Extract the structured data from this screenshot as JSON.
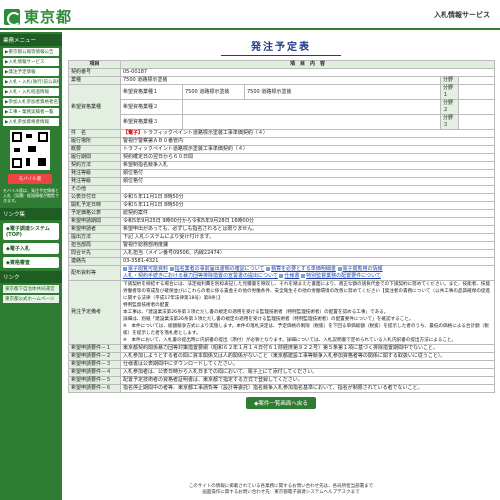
{
  "header": {
    "logo_text": "東京都",
    "service_title": "入札情報サービス"
  },
  "sidebar": {
    "section1": "業務メニュー",
    "items": [
      "▶東京都公報等情報公告",
      "▶入札情報サービス",
      "▶発注予定情報",
      "▶入札・入札(執行)前公表情報",
      "▶入札・入札経過情報",
      "▶参加入札参加者資格者名簿",
      "▶工事・業務実績者一覧",
      "▶入札参加資格者情報"
    ],
    "mobile_label": "モバイル版",
    "mobile_note": "モバイル版は、発注予定情報と入札（見積）経過情報が閲覧できます。",
    "section2": "リンク集",
    "links": [
      "◆電子調達システム(TOP)",
      "◆電子入札",
      "◆資格審査"
    ],
    "section3": "リンク",
    "links2": [
      "東京都下自治体共同運営",
      "東京都公式ホームページ"
    ]
  },
  "main": {
    "page_title": "発注予定表",
    "col_item": "項目",
    "col_content": "項　目　内　容",
    "rows": {
      "contract_no_label": "契約番号",
      "contract_no": "05-00187",
      "category_label": "業種",
      "category": "7500 道路標示塗装",
      "grade_label": "分野",
      "desired_label": "希望資格業種",
      "desired1_label": "希望資格業種１",
      "desired1_a": "7500 道路標示塗装",
      "desired1_b": "7500 道路標示塗装",
      "desired2_label": "希望資格業種２",
      "desired3_label": "希望資格業種３",
      "grade1": "分野１",
      "grade2": "分野２",
      "grade3": "分野３",
      "name_label": "件　名",
      "name_tag": "【電子】",
      "name_value": "トラフィックペイント道路標示塗装工事単価契約（４）",
      "place_label": "履行場所",
      "place": "警視庁警察署ＡＢ０番管内",
      "summary_label": "概要",
      "summary": "トラフィックペイント道路標示塗装工事単価契約（４）",
      "period_label": "履行期間",
      "period": "契約確定日の翌日から６０日間",
      "method_label": "契約方法",
      "method": "希望制指名競争入札",
      "dept_label": "発注等級",
      "dept": "順位格付",
      "requirement_label": "発注等級",
      "requirement": "順位格付",
      "other_label": "その他",
      "other": "",
      "announce_date_label": "公表日付日",
      "announce_date": "令和５年11月1日 8時50分",
      "open_label": "開札予定日時",
      "open": "令和５年11月1日 8時50分",
      "contract_type_label": "予定価格公表",
      "contract_type": "総契約案件",
      "apply_label": "希望申請期間",
      "apply": "令和5年9月25日 9時00分から令和5年9月28日 16時00分",
      "select_label": "希望申請者",
      "select": "希望申出があっても、必ずしも指名されるとは限りません。",
      "submit_label": "提出方法",
      "submit": "下記 入札システムにより受け付けます。",
      "contact_label": "担当部局",
      "contact": "警視庁総務部用度課",
      "place2_label": "問合せ先",
      "place2": "入札担当（メイン番号09506、内線22474）",
      "tel_label": "連絡先",
      "tel": "03-3581-4321",
      "docs_label": "配布資料等",
      "docs": [
        "電子閲覧可能資料",
        "指名業者の事前届出書類の確認について",
        "積算を必要とする単価明細書",
        "電子閲覧用の情報",
        "入札・契約手続きにおける暴力団等排除措置の宣誓書の提出について",
        "仕様書",
        "特別監督業務の配置要件について"
      ],
      "notes_label": "発注予定備考",
      "notes": "下請契約を締結する場合には、法定福利費を別枠表記した見積書を徴収し、それを踏まえた書面により、適正な額の請負代金での下請契約に努めてください。また、技能者、技能労働者等の育成及び確保並びにこれらの者に係る賃金その他の労働条件、安全衛生その他の労働環境の改善に努めてください【発注者の責務について（公共工事の品質確保の促進に関する法律（平成17年法律第18号）第8条）】\n特例監督技術者の配置\n本工事は、「建設業法第26条第３項ただし書の規定の適用を受ける監理技術者（特例監理技術者）の配置を認める工事」である。\n詳細は、別紙「建設業法第26条第３項ただし書の規定の適用を受ける監理技術者（特例監理技術者）の配置要件について」を確認すること。\n※　本件については、総額競争方式により実施します。本件の落札決定は、予定価格の制限（税抜）を下回る単価総額（税抜）を提示した者のうち、最低の価格による合計額（税抜）を提示した者を落札者とします。\n※　本件において、入札書の提出時に内訳書の提出（添付）が必要となります。詳細については、入札説明書で定められている入札内訳書の提出方法によること。",
      "req_label": "希望申請要件",
      "req1_label": "希望申請要件－１",
      "req1": "東京都契約関係暴力団等対策措置要綱（昭和６２年１月１４日付６１財経庶第９２２号）第５条第１項に基づく排除措置期間中でないこと。",
      "req2_label": "希望申請要件－２",
      "req2": "入札参加しようとする者の間に資本関係又は人的関係がないこと（東京都建設工事等競争入札参加資格者等の関係に関する取扱いに従うこと）。",
      "req3_label": "希望申請要件－３",
      "req3": "仕様書は公表期間中にダウンロードしてください。",
      "req4_label": "希望申請要件－４",
      "req4": "入札参加者は、公表日時から入札日までの間において、電子上にて添付してください。",
      "req5_label": "希望申請要件－５",
      "req5": "配置予定技術者の資格者証明書は、東京都で指定する方式で登録してください。",
      "req6_label": "希望申請要件－６",
      "req6": "指名停止期間中の者等、東京都工事請負等（設計等委託）指名競争入札参加指名基準において、指名が制限されている者でないこと。"
    },
    "back_button": "◆案件一覧画面へ戻る"
  },
  "footer": {
    "line1": "このサイトの情報に掲載されている各業務に関するお問い合わせ先は、各局所担当部署まで",
    "line2": "画面操作に関するお問い合わせ先：東京都電子調達システムヘルプデスクまで"
  },
  "colors": {
    "brand_green": "#2f7d32",
    "title_blue": "#1f3a8a",
    "label_bg": "#e3f0e1"
  }
}
